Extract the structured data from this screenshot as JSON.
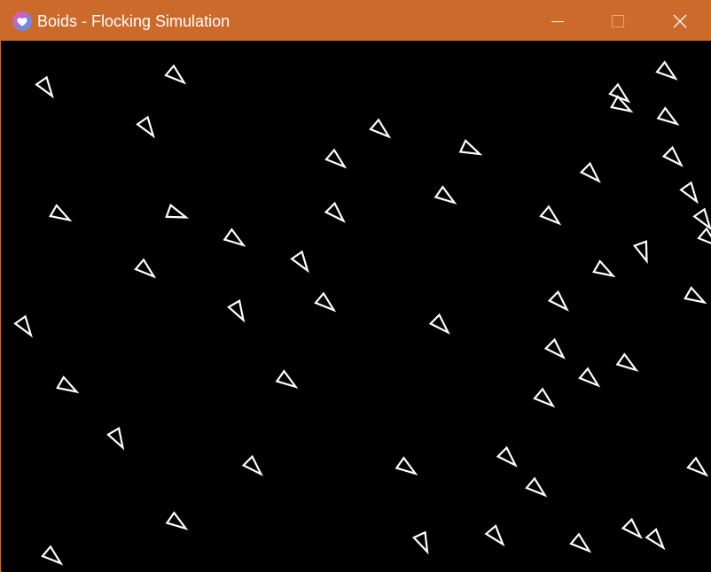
{
  "window": {
    "title": "Boids - Flocking Simulation",
    "titlebar_color": "#cc6a2c",
    "icon": "heart-app-icon",
    "controls": [
      {
        "name": "minimize",
        "icon": "minimize-icon"
      },
      {
        "name": "maximize",
        "icon": "maximize-icon",
        "disabled": true
      },
      {
        "name": "close",
        "icon": "close-icon"
      }
    ]
  },
  "simulation": {
    "background": "#000000",
    "boid_color": "#ffffff"
  }
}
